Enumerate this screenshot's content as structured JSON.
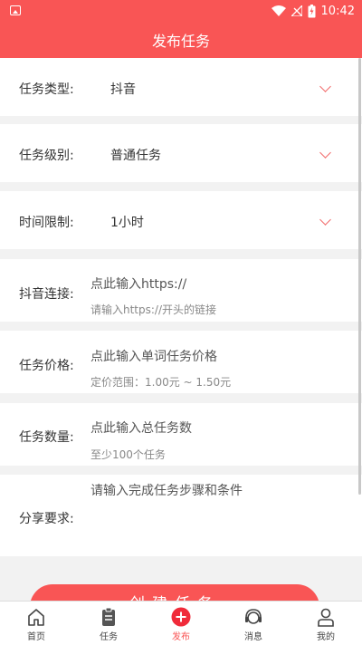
{
  "status_bar": {
    "time": "10:42"
  },
  "header": {
    "title": "发布任务"
  },
  "form": {
    "task_type": {
      "label": "任务类型:",
      "value": "抖音"
    },
    "task_level": {
      "label": "任务级别:",
      "value": "普通任务"
    },
    "time_limit": {
      "label": "时间限制:",
      "value": "1小时"
    },
    "douyin_link": {
      "label": "抖音连接:",
      "placeholder": "点此输入https://",
      "hint": "请输入https://开头的链接"
    },
    "task_price": {
      "label": "任务价格:",
      "placeholder": "点此输入单词任务价格",
      "hint": "定价范围：1.00元 ~ 1.50元"
    },
    "task_count": {
      "label": "任务数量:",
      "placeholder": "点此输入总任务数",
      "hint": "至少100个任务"
    },
    "share_req": {
      "label": "分享要求:",
      "placeholder": "请输入完成任务步骤和条件"
    }
  },
  "create_button": {
    "label": "创建任务"
  },
  "tabbar": {
    "items": [
      {
        "label": "首页",
        "icon": "home-icon"
      },
      {
        "label": "任务",
        "icon": "clipboard-icon"
      },
      {
        "label": "发布",
        "icon": "plus-circle-icon"
      },
      {
        "label": "消息",
        "icon": "headset-icon"
      },
      {
        "label": "我的",
        "icon": "user-icon"
      }
    ]
  },
  "colors": {
    "accent": "#f95555"
  }
}
